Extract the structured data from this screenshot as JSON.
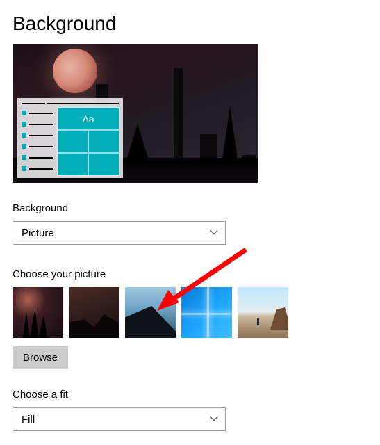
{
  "page": {
    "title": "Background"
  },
  "preview": {
    "sample_text": "Aa"
  },
  "background_section": {
    "label": "Background",
    "selected": "Picture"
  },
  "picture_section": {
    "label": "Choose your picture",
    "thumbs": [
      {
        "name": "dark-moon-columns"
      },
      {
        "name": "dark-creature"
      },
      {
        "name": "blue-mountains"
      },
      {
        "name": "windows-light"
      },
      {
        "name": "beach-rock"
      }
    ],
    "browse_label": "Browse"
  },
  "fit_section": {
    "label": "Choose a fit",
    "selected": "Fill"
  },
  "annotation": {
    "pointer_target": "blue-mountains-thumbnail"
  }
}
